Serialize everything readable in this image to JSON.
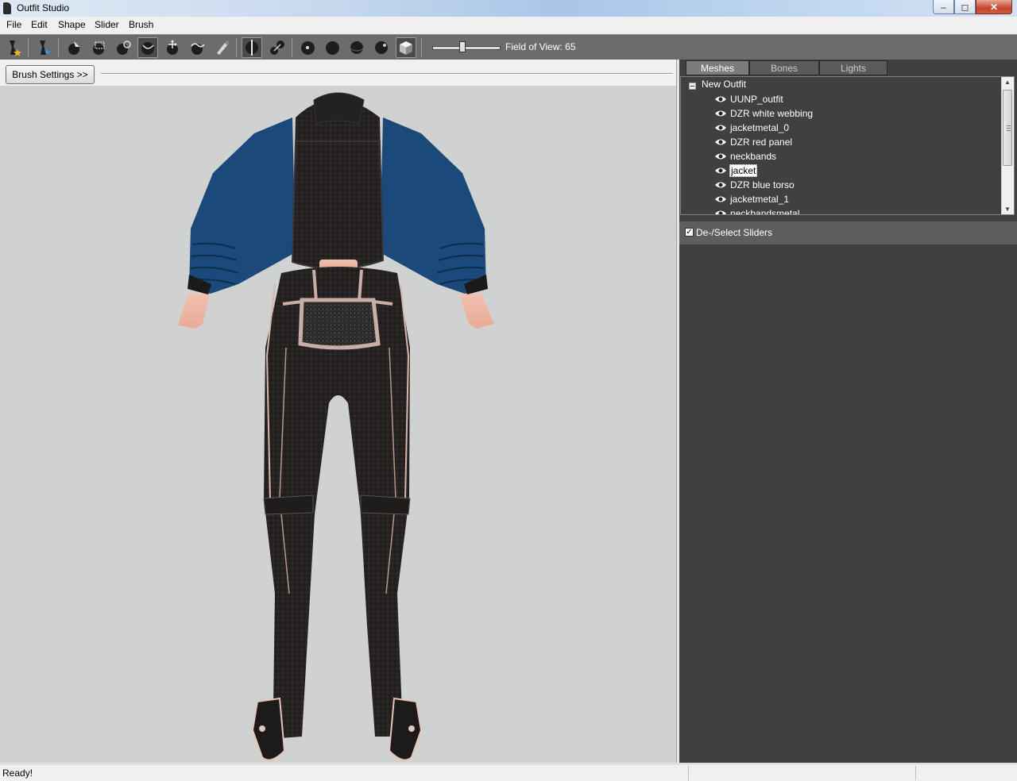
{
  "window": {
    "title": "Outfit Studio",
    "min_glyph": "‒",
    "max_glyph": "◻",
    "close_glyph": "✕"
  },
  "menu": {
    "items": [
      "File",
      "Edit",
      "Shape",
      "Slider",
      "Brush"
    ]
  },
  "toolbar": {
    "tools": [
      "new-project-icon",
      "load-reference-icon",
      "select-brush-icon",
      "mask-brush-icon",
      "inflate-brush-icon",
      "deflate-brush-icon",
      "move-brush-icon",
      "smooth-brush-icon",
      "weight-brush-icon",
      "mirror-toggle-icon",
      "connected-only-icon",
      "vertex-view-icon",
      "flat-shading-icon",
      "wireframe-icon",
      "lighting-icon",
      "texture-view-icon"
    ],
    "fov_label": "Field of View: 65",
    "fov_value": 65
  },
  "left_panel": {
    "brush_settings_label": "Brush Settings >>"
  },
  "right_panel": {
    "tabs": [
      "Meshes",
      "Bones",
      "Lights"
    ],
    "selected_tab": "Meshes",
    "tree_root": "New Outfit",
    "meshes": [
      "UUNP_outfit",
      "DZR white webbing",
      "jacketmetal_0",
      "DZR red panel",
      "neckbands",
      "jacket",
      "DZR blue torso",
      "jacketmetal_1",
      "neckbandsmetal"
    ],
    "selected_mesh": "jacket",
    "slider_toggle_label": "De-/Select Sliders",
    "slider_toggle_checked": true
  },
  "status": {
    "text": "Ready!"
  },
  "colors": {
    "toolbar_bg": "#6c6c6c",
    "panel_bg": "#404040",
    "viewport_bg": "#d0d2d2",
    "jacket_blue": "#1b4a7a"
  }
}
